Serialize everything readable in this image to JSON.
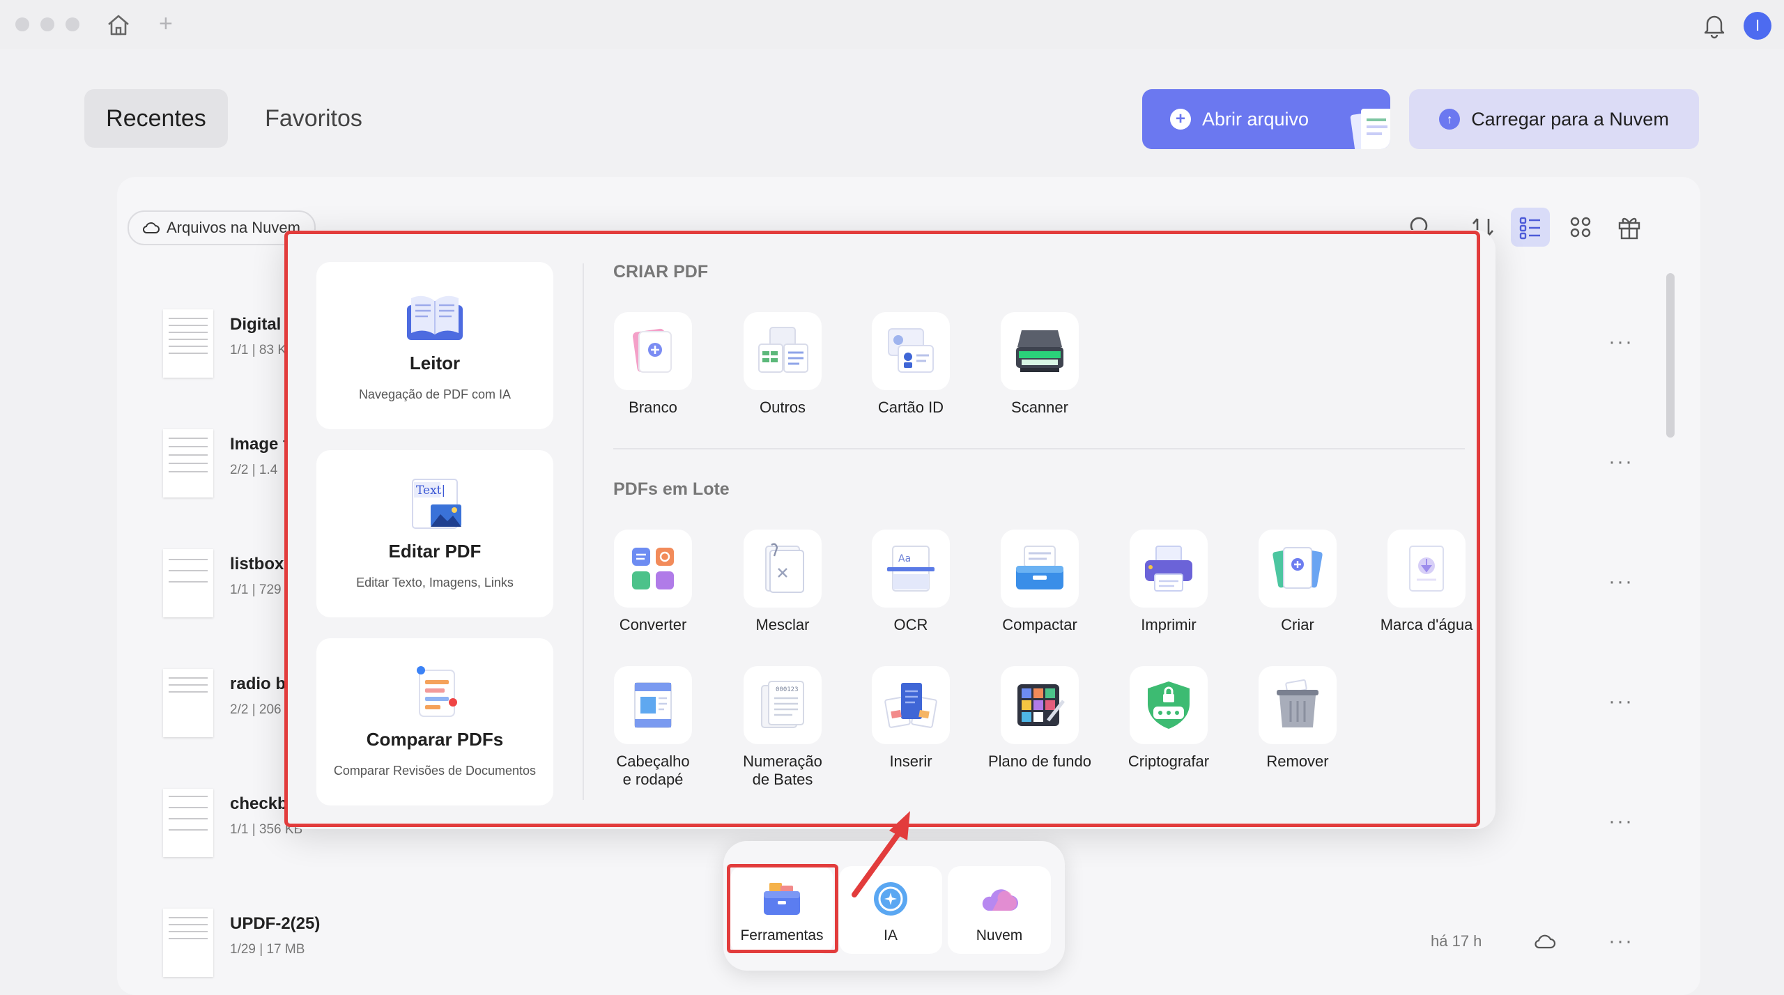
{
  "header": {
    "tabs": [
      {
        "label": "Recentes",
        "active": true
      },
      {
        "label": "Favoritos",
        "active": false
      }
    ],
    "open_button": "Abrir arquivo",
    "upload_button": "Carregar para a Nuvem",
    "avatar_initial": "I"
  },
  "toolbar": {
    "cloud_files_label": "Arquivos na Nuvem"
  },
  "files": [
    {
      "name": "Digital S",
      "meta": "1/1  |  83 K"
    },
    {
      "name": "Image f",
      "meta": "2/2  |  1.4"
    },
    {
      "name": "listbox&",
      "meta": "1/1  |  729"
    },
    {
      "name": "radio bu",
      "meta": "2/2  |  206"
    },
    {
      "name": "checkbo",
      "meta": "1/1  |  356 KB"
    },
    {
      "name": "UPDF-2(25)",
      "meta": "1/29  |  17 MB",
      "time": "há 17 h"
    }
  ],
  "panel": {
    "left_cards": [
      {
        "title": "Leitor",
        "subtitle": "Navegação de PDF com IA",
        "icon": "book-icon"
      },
      {
        "title": "Editar PDF",
        "subtitle": "Editar Texto, Imagens, Links",
        "icon": "text-edit-icon"
      },
      {
        "title": "Comparar PDFs",
        "subtitle": "Comparar Revisões de Documentos",
        "icon": "compare-icon"
      }
    ],
    "create_section": {
      "title": "CRIAR PDF",
      "tools": [
        "Branco",
        "Outros",
        "Cartão ID",
        "Scanner"
      ]
    },
    "batch_section": {
      "title": "PDFs em Lote",
      "row1": [
        "Converter",
        "Mesclar",
        "OCR",
        "Compactar",
        "Imprimir",
        "Criar",
        "Marca d'água"
      ],
      "row2": [
        "Cabeçalho\ne rodapé",
        "Numeração\nde Bates",
        "Inserir",
        "Plano de fundo",
        "Criptografar",
        "Remover"
      ]
    },
    "bates_sample": "000123"
  },
  "dock": {
    "items": [
      {
        "label": "Ferramentas",
        "icon": "toolbox-icon"
      },
      {
        "label": "IA",
        "icon": "ai-icon"
      },
      {
        "label": "Nuvem",
        "icon": "cloud-icon"
      }
    ]
  },
  "colors": {
    "accent": "#6b78f0",
    "highlight": "#e23c3c",
    "upload_bg": "#dcdcf6"
  }
}
